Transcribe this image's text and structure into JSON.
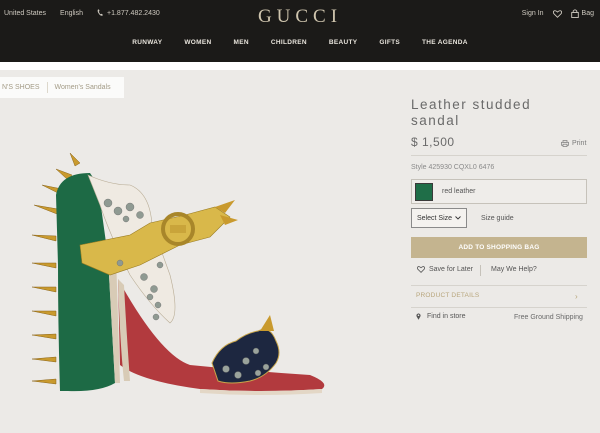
{
  "header": {
    "country": "United States",
    "language": "English",
    "phone": "+1.877.482.2430",
    "logo": "GUCCI",
    "sign_in": "Sign In",
    "bag": "Bag"
  },
  "nav": [
    "RUNWAY",
    "WOMEN",
    "MEN",
    "CHILDREN",
    "BEAUTY",
    "GIFTS",
    "THE AGENDA"
  ],
  "breadcrumb": [
    "N'S SHOES",
    "Women's Sandals"
  ],
  "product": {
    "title": "Leather studded sandal",
    "price": "$ 1,500",
    "print": "Print",
    "style": "Style 425930 CQXL0 6476",
    "color_label": "red leather",
    "color_swatch": "#1f6e48",
    "size_select": "Select Size",
    "size_guide": "Size guide",
    "add_to_bag": "ADD TO SHOPPING BAG",
    "save_for_later": "Save for Later",
    "may_we_help": "May We Help?",
    "product_details": "PRODUCT DETAILS",
    "find_in_store": "Find in store",
    "shipping": "Free Ground Shipping"
  },
  "colors": {
    "header_bg": "#1b1a18",
    "accent_gold": "#c4b48f",
    "page_bg": "#eceae7"
  }
}
